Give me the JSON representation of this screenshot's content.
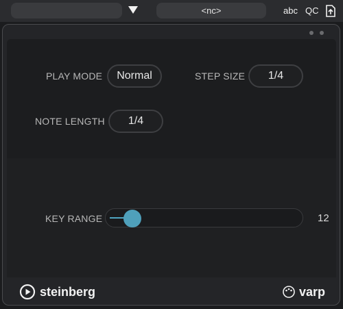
{
  "header": {
    "preset_value": "",
    "no_controller_label": "<nc>",
    "abc_label": "abc",
    "qc_label": "QC",
    "icons": [
      "dropdown-arrow-icon",
      "export-icon"
    ]
  },
  "controls": {
    "play_mode": {
      "label": "PLAY MODE",
      "value": "Normal"
    },
    "step_size": {
      "label": "STEP SIZE",
      "value": "1/4"
    },
    "note_length": {
      "label": "NOTE LENGTH",
      "value": "1/4"
    },
    "key_range": {
      "label": "KEY RANGE",
      "value": "12",
      "level": 0.11
    }
  },
  "footer": {
    "brand_name": "steinberg",
    "plugin_name": "varp",
    "icons": [
      "steinberg-play-icon",
      "varp-palette-icon"
    ]
  },
  "colors": {
    "accent": "#4fa0bb",
    "background": "#1b1c1e",
    "panel": "#242528",
    "text": "#e8e8e8",
    "label": "#b8b8b8"
  }
}
